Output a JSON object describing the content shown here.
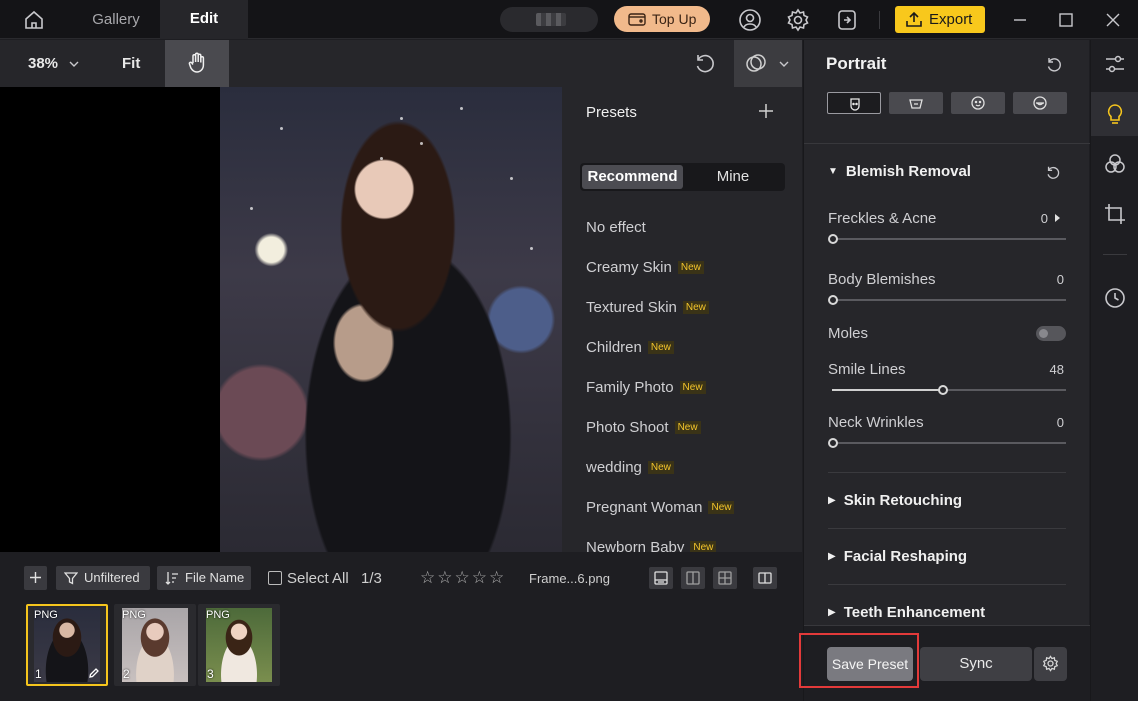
{
  "topbar": {
    "tabs": [
      {
        "label": "Gallery"
      },
      {
        "label": "Edit"
      }
    ],
    "topup_label": "Top Up",
    "export_label": "Export"
  },
  "toolbar": {
    "zoom": "38%",
    "fit_label": "Fit"
  },
  "presets": {
    "title": "Presets",
    "tabs": [
      {
        "label": "Recommend"
      },
      {
        "label": "Mine"
      }
    ],
    "new_badge": "New",
    "items": [
      {
        "label": "No effect",
        "is_new": false
      },
      {
        "label": "Creamy Skin",
        "is_new": true
      },
      {
        "label": "Textured Skin",
        "is_new": true
      },
      {
        "label": "Children",
        "is_new": true
      },
      {
        "label": "Family Photo",
        "is_new": true
      },
      {
        "label": "Photo Shoot",
        "is_new": true
      },
      {
        "label": "wedding",
        "is_new": true
      },
      {
        "label": "Pregnant Woman",
        "is_new": true
      },
      {
        "label": "Newborn Baby",
        "is_new": true
      }
    ]
  },
  "filmstrip": {
    "filter_label": "Unfiltered",
    "sort_label": "File Name",
    "select_all_label": "Select All",
    "count": "1/3",
    "stars": "☆☆☆☆☆",
    "filename": "Frame...6.png",
    "thumbs": [
      {
        "type": "PNG",
        "index": "1",
        "selected": true
      },
      {
        "type": "PNG",
        "index": "2",
        "selected": false
      },
      {
        "type": "PNG",
        "index": "3",
        "selected": false
      }
    ]
  },
  "panel": {
    "title": "Portrait",
    "blemish": {
      "title": "Blemish Removal",
      "freckles": {
        "label": "Freckles & Acne",
        "value": "0"
      },
      "body": {
        "label": "Body Blemishes",
        "value": "0"
      },
      "moles": {
        "label": "Moles",
        "on": false
      },
      "smile": {
        "label": "Smile Lines",
        "value": "48"
      },
      "neck": {
        "label": "Neck Wrinkles",
        "value": "0"
      }
    },
    "sections": [
      {
        "title": "Skin Retouching"
      },
      {
        "title": "Facial Reshaping"
      },
      {
        "title": "Teeth Enhancement"
      }
    ],
    "save_preset_label": "Save Preset",
    "sync_label": "Sync"
  },
  "colors": {
    "accent_yellow": "#f8c81c",
    "topup_peach": "#f1b98b",
    "highlight_red": "#e33a3a",
    "new_badge": "#f5c62b"
  }
}
